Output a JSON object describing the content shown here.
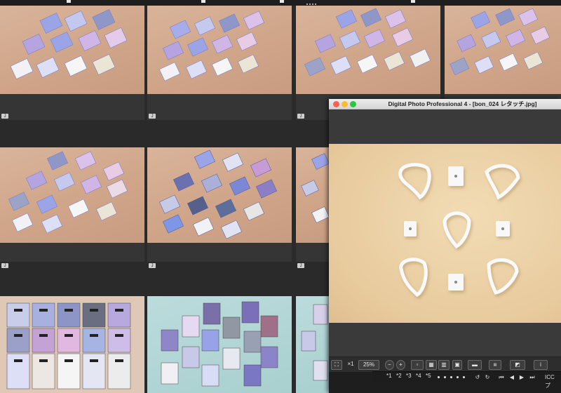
{
  "window": {
    "title": "Digital Photo Professional 4 - [bon_024 レタッチ.jpg]"
  },
  "toolbar": {
    "fit_label": "⛶",
    "x1_label": "×1",
    "zoom_value": "25%",
    "zoom_out_label": "−",
    "zoom_in_label": "+"
  },
  "ratings": {
    "items": [
      "1",
      "2",
      "3",
      "4",
      "5"
    ]
  },
  "statusbar": {
    "icc_label": "ICC プ"
  },
  "thumbnails": {
    "tag_labels": [
      "J",
      "J",
      "J",
      "J",
      "J",
      "J"
    ]
  },
  "colors": {
    "background_tan": "#d6ad91",
    "background_teal": "#b4d6d6",
    "canvas_cream": "#eed5aa",
    "close": "#fe5f57",
    "minimize": "#febc2e",
    "maximize": "#28c840"
  }
}
